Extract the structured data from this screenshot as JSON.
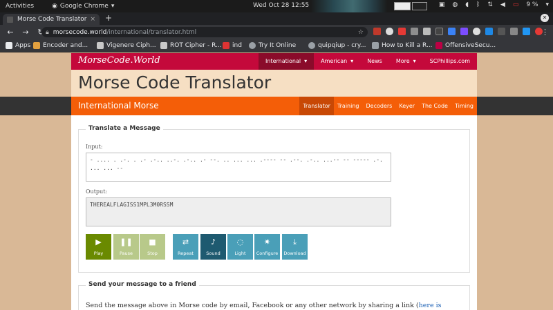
{
  "system_bar": {
    "activities": "Activities",
    "app": "Google Chrome",
    "clock": "Wed Oct 28  12:55",
    "battery": "9 %"
  },
  "browser": {
    "tab_title": "Morse Code Translator",
    "new_tab": "+",
    "url_host": "morsecode.world",
    "url_path": "/international/translator.html"
  },
  "bookmarks": [
    {
      "label": "Apps",
      "color": "#e8eaed"
    },
    {
      "label": "Encoder and...",
      "color": "#e2a03f"
    },
    {
      "label": "Vigenere Ciph...",
      "color": "#c8c8c8"
    },
    {
      "label": "ROT Cipher - R...",
      "color": "#c8c8c8"
    },
    {
      "label": "ind",
      "color": "#d33"
    },
    {
      "label": "Try It Online",
      "color": "#9aa0a6"
    },
    {
      "label": "quipqiup - cry...",
      "color": "#9aa0a6"
    },
    {
      "label": "How to Kill a R...",
      "color": "#9aa0a6"
    },
    {
      "label": "OffensiveSecu...",
      "color": "#b04"
    }
  ],
  "site": {
    "logo": "MorseCode.World",
    "top_nav": [
      {
        "label": "International",
        "caret": "▾",
        "active": true
      },
      {
        "label": "American",
        "caret": "▾",
        "active": false
      },
      {
        "label": "News",
        "caret": "",
        "active": false
      },
      {
        "label": "More",
        "caret": "▾",
        "active": false
      },
      {
        "label": "SCPhillips.com",
        "caret": "",
        "active": false
      }
    ],
    "page_title": "Morse Code Translator",
    "section": "International Morse",
    "sub_nav": [
      {
        "label": "Translator",
        "active": true
      },
      {
        "label": "Training",
        "active": false
      },
      {
        "label": "Decoders",
        "active": false
      },
      {
        "label": "Keyer",
        "active": false
      },
      {
        "label": "The Code",
        "active": false
      },
      {
        "label": "Timing",
        "active": false
      }
    ]
  },
  "translator": {
    "legend": "Translate a Message",
    "input_label": "Input:",
    "input_value": "- .... .  .-. . .- .-..   ..-. .-.. .- --.  .. ...   ... .---- -- .--. .-.. ...-- -- ----- .-. ... ... --",
    "output_label": "Output:",
    "output_value": "THEREALFLAGISS1MPL3M0RSSM",
    "buttons": [
      {
        "id": "play",
        "label": "Play",
        "glyph": "▶",
        "color": "#6a8a00"
      },
      {
        "id": "pause",
        "label": "Pause",
        "glyph": "❚❚",
        "color": "#b8c98a"
      },
      {
        "id": "stop",
        "label": "Stop",
        "glyph": "■",
        "color": "#b8c98a"
      },
      {
        "id": "repeat",
        "label": "Repeat",
        "glyph": "⇄",
        "color": "#4a9fb8"
      },
      {
        "id": "sound",
        "label": "Sound",
        "glyph": "♪",
        "color": "#1e5a70"
      },
      {
        "id": "light",
        "label": "Light",
        "glyph": "◌",
        "color": "#4a9fb8"
      },
      {
        "id": "configure",
        "label": "Configure",
        "glyph": "✷",
        "color": "#4a9fb8"
      },
      {
        "id": "download",
        "label": "Download",
        "glyph": "⤓",
        "color": "#4a9fb8"
      }
    ]
  },
  "share": {
    "legend": "Send your message to a friend",
    "text": "Send the message above in Morse code by email, Facebook or any other network by sharing a link (",
    "link": "here is"
  }
}
